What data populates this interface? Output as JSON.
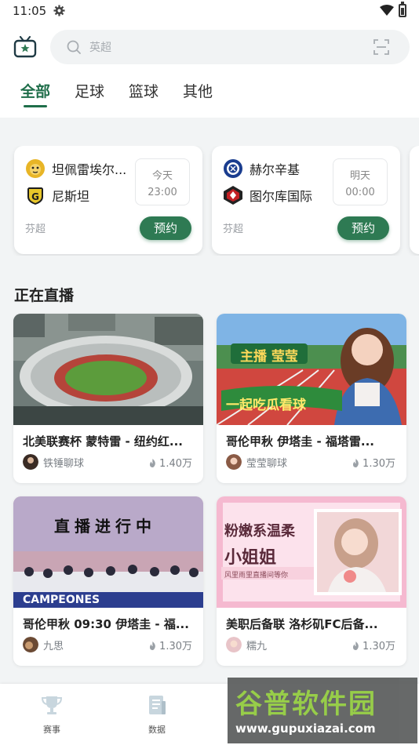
{
  "status_bar": {
    "time": "11:05"
  },
  "search": {
    "placeholder": "英超"
  },
  "tabs": [
    {
      "label": "全部",
      "active": true
    },
    {
      "label": "足球",
      "active": false
    },
    {
      "label": "篮球",
      "active": false
    },
    {
      "label": "其他",
      "active": false
    }
  ],
  "schedule": [
    {
      "home": "坦佩雷埃尔...",
      "away": "尼斯坦",
      "day": "今天",
      "time": "23:00",
      "league": "芬超",
      "button": "预约"
    },
    {
      "home": "赫尔辛基",
      "away": "图尔库国际",
      "day": "明天",
      "time": "00:00",
      "league": "芬超",
      "button": "预约"
    }
  ],
  "live_section": {
    "title": "正在直播"
  },
  "live": [
    {
      "title": "北美联赛杯 蒙特雷 - 纽约红...",
      "anchor": "铁锤聊球",
      "heat": "1.40万",
      "overlay": ""
    },
    {
      "title": "哥伦甲秋  伊塔圭 - 福塔雷...",
      "anchor": "莹莹聊球",
      "heat": "1.30万",
      "overlay": "主播 莹莹",
      "overlay2": "一起吃瓜看球"
    },
    {
      "title": "哥伦甲秋 09:30 伊塔圭 - 福...",
      "anchor": "九思",
      "heat": "1.30万",
      "overlay": "直播进行中",
      "overlay2": "CAMPEONES"
    },
    {
      "title": "美职后备联 洛杉矶FC后备...",
      "anchor": "糯九",
      "heat": "1.30万",
      "overlay": "粉嫩系温柔",
      "overlay2": "小姐姐",
      "overlay3": "风里雨里直播间等你"
    }
  ],
  "bottom_nav": [
    {
      "label": "赛事",
      "icon": "trophy-icon"
    },
    {
      "label": "数据",
      "icon": "data-doc-icon"
    }
  ],
  "watermark": {
    "line1": "谷普软件园",
    "line2": "www.gupuxiazai.com"
  },
  "colors": {
    "accent": "#1f6e4a",
    "button": "#2e7a53",
    "background": "#f2f4f5"
  }
}
